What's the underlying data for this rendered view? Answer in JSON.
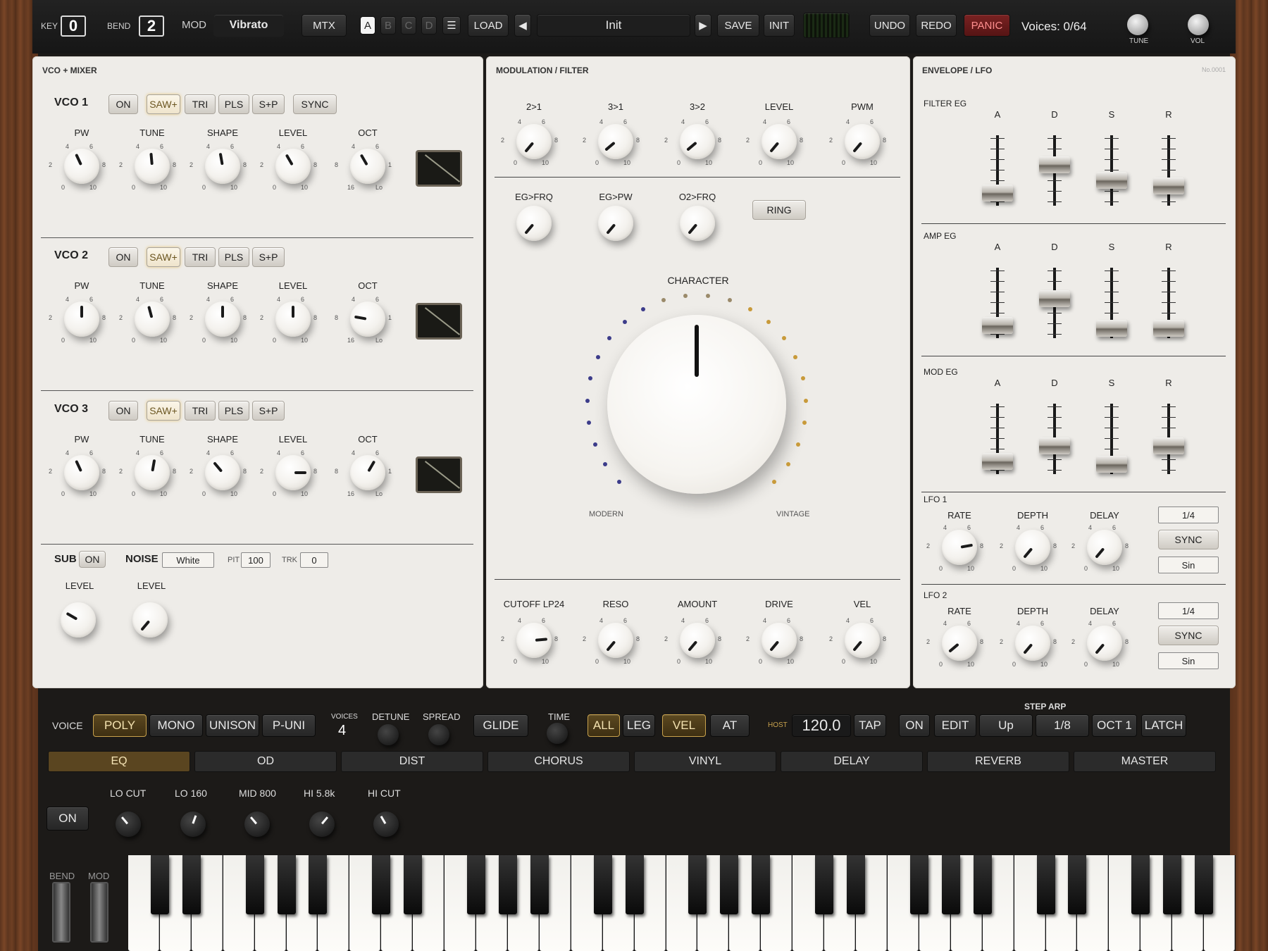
{
  "topbar": {
    "key_label": "KEY",
    "key_value": "0",
    "bend_label": "BEND",
    "bend_value": "2",
    "mod_label": "MOD",
    "mod_value": "Vibrato",
    "mtx": "MTX",
    "slots": [
      "A",
      "B",
      "C",
      "D"
    ],
    "menu_icon": "hamburger-icon",
    "load": "LOAD",
    "prev_icon": "triangle-left-icon",
    "preset": "Init",
    "next_icon": "triangle-right-icon",
    "save": "SAVE",
    "init": "INIT",
    "undo": "UNDO",
    "redo": "REDO",
    "panic": "PANIC",
    "voices": "Voices: 0/64",
    "tune": "TUNE",
    "vol": "VOL"
  },
  "vco_panel": {
    "title": "VCO + MIXER",
    "knob_labels": [
      "PW",
      "TUNE",
      "SHAPE",
      "LEVEL",
      "OCT"
    ],
    "scale": {
      "min": "0",
      "max": "10",
      "l": "2",
      "r": "8",
      "t1": "4",
      "t2": "6",
      "oct_min": "16",
      "oct_max": "Lo",
      "oct_l": "8",
      "oct_r": "1"
    },
    "waves": [
      "SAW+",
      "TRI",
      "PLS",
      "S+P"
    ],
    "on": "ON",
    "sync": "SYNC",
    "rows": [
      {
        "name": "VCO 1"
      },
      {
        "name": "VCO 2"
      },
      {
        "name": "VCO 3"
      }
    ],
    "sub": "SUB",
    "sub_on": "ON",
    "noise": "NOISE",
    "noise_type": "White",
    "pit": "PIT",
    "pit_value": "100",
    "trk": "TRK",
    "trk_value": "0",
    "level": "LEVEL"
  },
  "mod_panel": {
    "title": "MODULATION / FILTER",
    "row1": [
      "2>1",
      "3>1",
      "3>2",
      "LEVEL",
      "PWM"
    ],
    "row2": [
      "EG>FRQ",
      "EG>PW",
      "O2>FRQ"
    ],
    "ring": "RING",
    "character": "CHARACTER",
    "modern": "MODERN",
    "vintage": "VINTAGE",
    "filter": [
      "CUTOFF LP24",
      "RESO",
      "AMOUNT",
      "DRIVE",
      "VEL"
    ]
  },
  "env_panel": {
    "title": "ENVELOPE / LFO",
    "serial": "No.0001",
    "adsr": [
      "A",
      "D",
      "S",
      "R"
    ],
    "egs": [
      "FILTER EG",
      "AMP EG",
      "MOD EG"
    ],
    "lfo1": "LFO 1",
    "lfo2": "LFO 2",
    "lfo_knobs": [
      "RATE",
      "DEPTH",
      "DELAY"
    ],
    "division": "1/4",
    "sync": "SYNC",
    "wave": "Sin"
  },
  "voice_bar": {
    "voice": "VOICE",
    "modes": [
      "POLY",
      "MONO",
      "UNISON",
      "P-UNI"
    ],
    "voices_label": "VOICES",
    "voices_value": "4",
    "detune": "DETUNE",
    "spread": "SPREAD",
    "glide": "GLIDE",
    "time": "TIME",
    "all": "ALL",
    "leg": "LEG",
    "vel": "VEL",
    "at": "AT",
    "host": "HOST",
    "bpm": "120.0",
    "tap": "TAP",
    "step_arp": "STEP ARP",
    "arp_on": "ON",
    "arp_edit": "EDIT",
    "arp_dir": "Up",
    "arp_div": "1/8",
    "arp_oct": "OCT 1",
    "arp_latch": "LATCH"
  },
  "fx": {
    "tabs": [
      "EQ",
      "OD",
      "DIST",
      "CHORUS",
      "VINYL",
      "DELAY",
      "REVERB",
      "MASTER"
    ],
    "on": "ON",
    "knobs": [
      "LO CUT",
      "LO 160",
      "MID 800",
      "HI 5.8k",
      "HI CUT"
    ]
  },
  "wheels": {
    "bend": "BEND",
    "mod": "MOD"
  }
}
